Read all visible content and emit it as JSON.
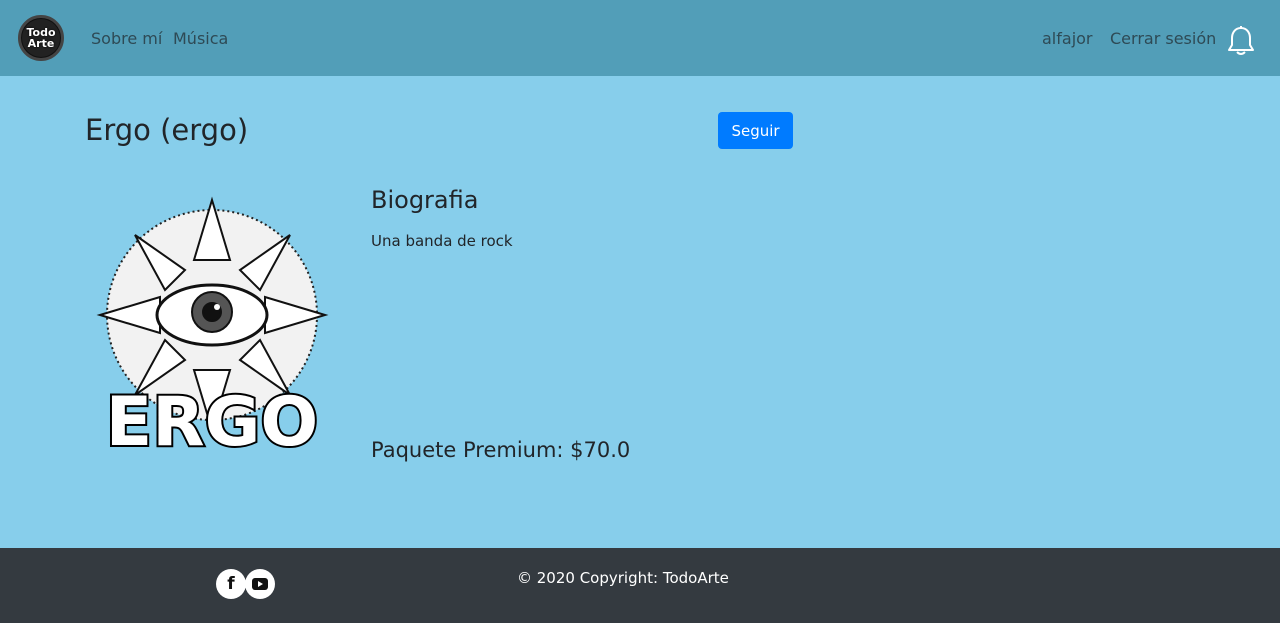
{
  "header": {
    "logo_text_top": "Todo",
    "logo_text_bottom": "Arte",
    "nav": [
      {
        "label": "Sobre mí"
      },
      {
        "label": "Música"
      }
    ],
    "username": "alfajor",
    "logout_label": "Cerrar sesión",
    "notification_icon": "bell-icon"
  },
  "profile": {
    "title": "Ergo (ergo)",
    "follow_label": "Seguir",
    "artwork_text": "ERGO",
    "bio_heading": "Biografia",
    "bio_text": "Una banda de rock",
    "premium_label": "Paquete Premium: $70.0"
  },
  "footer": {
    "copyright": "© 2020 Copyright: TodoArte",
    "social": [
      {
        "icon": "facebook-icon",
        "glyph": "f"
      },
      {
        "icon": "youtube-icon",
        "glyph": "▶"
      }
    ]
  },
  "colors": {
    "navbar": "#529eb8",
    "background": "#87ceeb",
    "button": "#007bff",
    "footer": "#343a40"
  }
}
